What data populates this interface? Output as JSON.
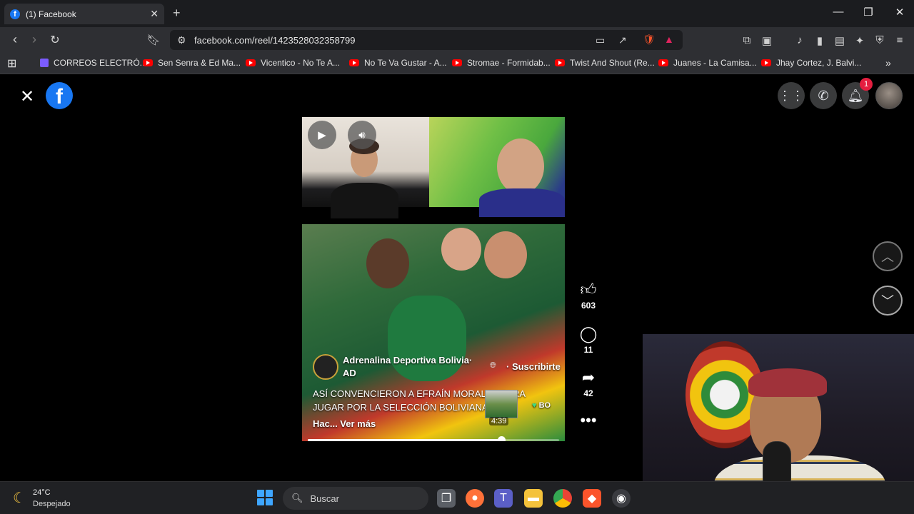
{
  "browser": {
    "tab_title": "(1) Facebook",
    "tab_favicon": "f",
    "url": "facebook.com/reel/1423528032358799",
    "bookmarks": [
      {
        "label": "CORREOS ELECTRÓ...",
        "icon": "list-icon"
      },
      {
        "label": "Sen Senra & Ed Ma...",
        "icon": "youtube-icon"
      },
      {
        "label": "Vicentico - No Te A...",
        "icon": "youtube-icon"
      },
      {
        "label": "No Te Va Gustar - A...",
        "icon": "youtube-icon"
      },
      {
        "label": "Stromae - Formidab...",
        "icon": "youtube-icon"
      },
      {
        "label": "Twist And Shout (Re...",
        "icon": "youtube-icon"
      },
      {
        "label": "Juanes - La Camisa...",
        "icon": "youtube-icon"
      },
      {
        "label": "Jhay Cortez, J. Balvi...",
        "icon": "youtube-icon"
      }
    ]
  },
  "facebook": {
    "logo": "f",
    "notification_count": "1",
    "reel": {
      "author": "Adrenalina Deportiva Bolivia·",
      "author_suffix": "AD",
      "subscribe_label": "· Suscribirte",
      "caption_line1": "ASÍ CONVENCIERON A EFRAÍN MORALES PARA",
      "caption_line2": "JUGAR POR LA SELECCIÓN BOLIVIANA",
      "country_tag": "BO",
      "see_more": "Hac... Ver más",
      "preview_time": "4:39",
      "progress_fraction": 0.77
    },
    "actions": {
      "likes": "603",
      "comments": "11",
      "shares": "42"
    }
  },
  "taskbar": {
    "temperature": "24°C",
    "weather": "Despejado",
    "search_placeholder": "Buscar"
  },
  "colors": {
    "facebook_blue": "#1877f2",
    "notification_red": "#e41e3f",
    "youtube_red": "#ff0000"
  }
}
